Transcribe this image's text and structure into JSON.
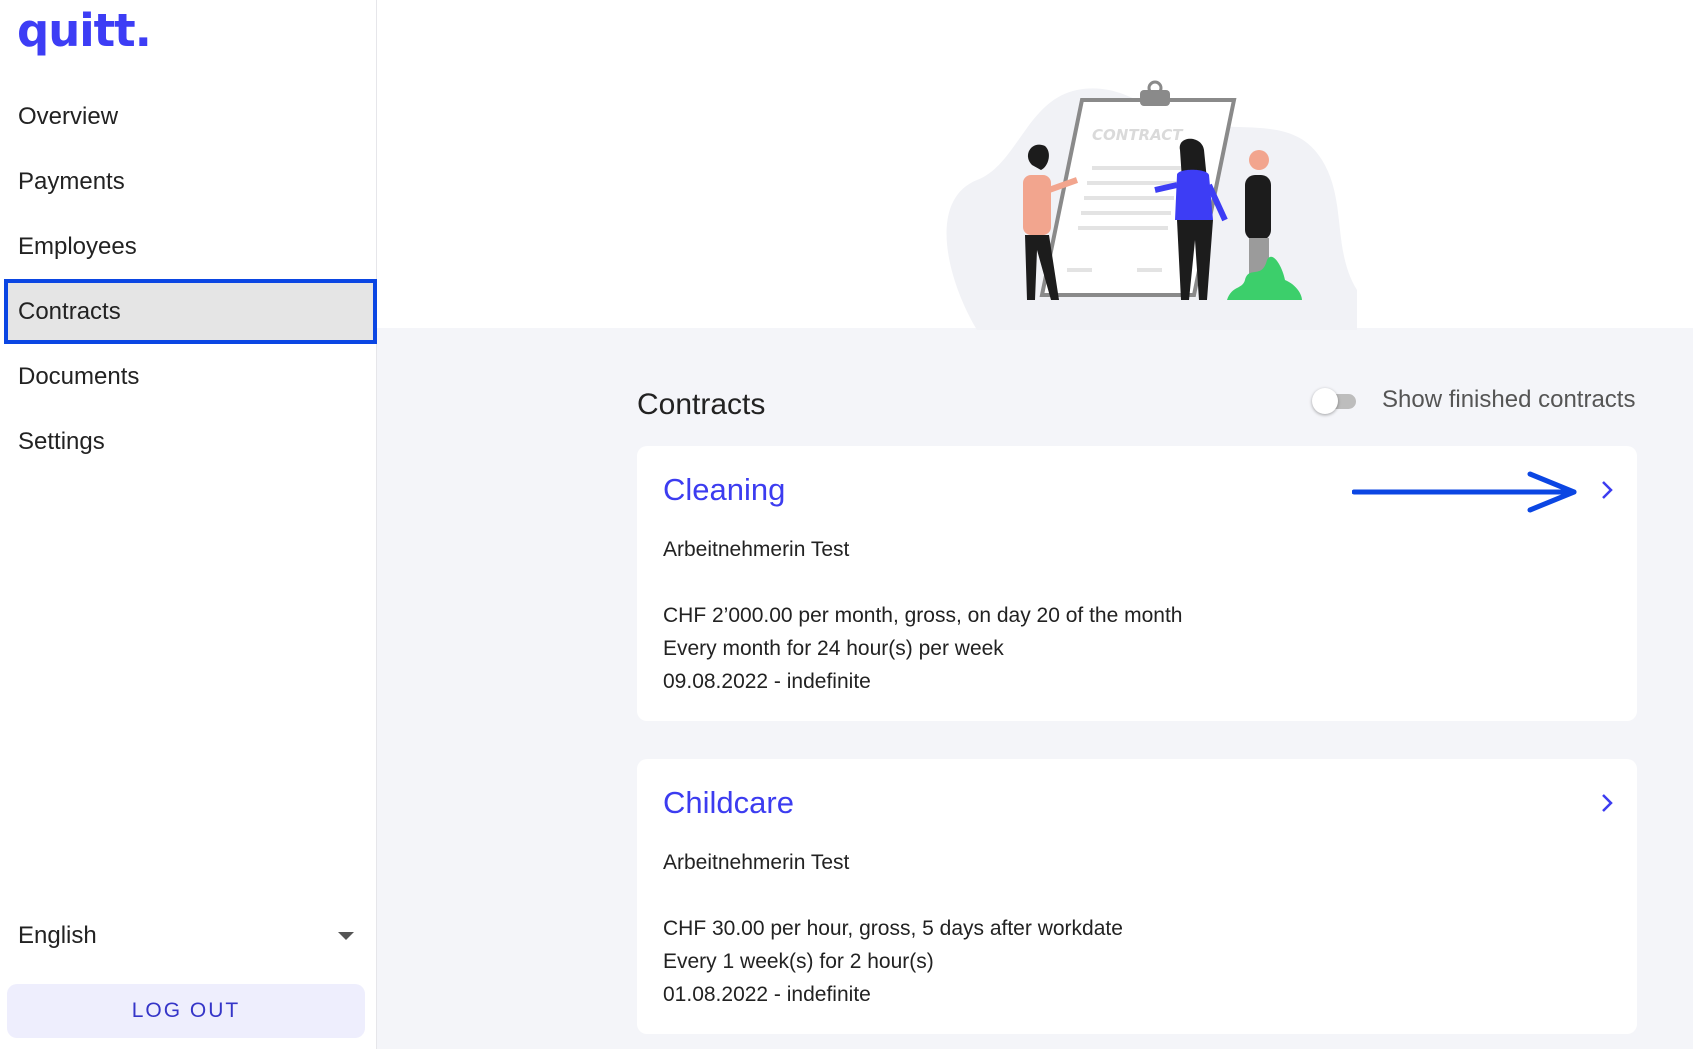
{
  "app": {
    "logo": "quitt."
  },
  "sidebar": {
    "items": [
      {
        "label": "Overview"
      },
      {
        "label": "Payments"
      },
      {
        "label": "Employees"
      },
      {
        "label": "Contracts",
        "active": true
      },
      {
        "label": "Documents"
      },
      {
        "label": "Settings"
      }
    ],
    "language": "English",
    "logout_label": "LOG OUT"
  },
  "hero": {
    "illustration_text": "CONTRACT"
  },
  "main": {
    "title": "Contracts",
    "toggle": {
      "label": "Show finished contracts",
      "checked": false
    },
    "contracts": [
      {
        "title": "Cleaning",
        "employee": "Arbeitnehmerin Test",
        "salary": "CHF 2’000.00 per month, gross, on day 20 of the month",
        "schedule": "Every month for 24 hour(s) per week",
        "period": "09.08.2022 - indefinite"
      },
      {
        "title": "Childcare",
        "employee": "Arbeitnehmerin Test",
        "salary": "CHF 30.00 per hour, gross, 5 days after workdate",
        "schedule": "Every 1 week(s) for 2 hour(s)",
        "period": "01.08.2022 - indefinite"
      }
    ]
  },
  "colors": {
    "brand": "#3d3df5",
    "link": "#3c3cf0",
    "highlight": "#0b46e3",
    "background": "#f4f5f9"
  }
}
